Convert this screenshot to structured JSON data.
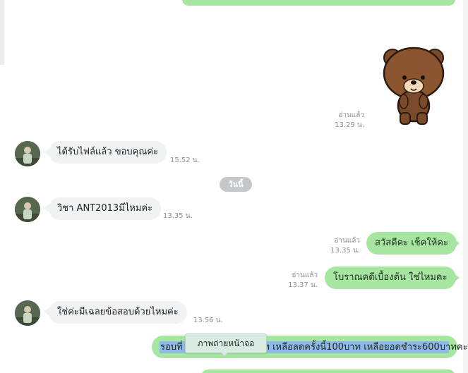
{
  "messages": [
    {
      "text": "ได้รับไฟล์แล้ว ขอบคุณค่ะ",
      "time": "15.52 น."
    },
    {
      "text": "วิชา ANT2013มีไหมค่ะ",
      "time": "13.35 น."
    },
    {
      "text": "สวัสดีคะ เช็คให้คะ",
      "read": "อ่านแล้ว",
      "time": "13.35 น."
    },
    {
      "text": "โบราณคดีเบื้องต้น ใช่ไหมคะ",
      "read": "อ่านแล้ว",
      "time": "13.37 น."
    },
    {
      "text": "ใช่ค่ะมีเฉลยข้อสอบด้วยไหมค่ะ",
      "time": "13.56 น."
    },
    {
      "text": "รอบที่ 1 ชำระแล้ว 400บาท เหลือลดครั้งนี้100บาท เหลือยอดชำระ600บาทคะ"
    }
  ],
  "sticker": {
    "read": "อ่านแล้ว",
    "time": "13.29 น.",
    "icon": "brown-bear-sticker"
  },
  "date_separator": "วันนี้",
  "tooltip": "ภาพถ่ายหน้าจอ",
  "colors": {
    "outgoing": "#a6e6a1",
    "incoming": "#f1f2f3",
    "selection": "#8fb9e8"
  }
}
